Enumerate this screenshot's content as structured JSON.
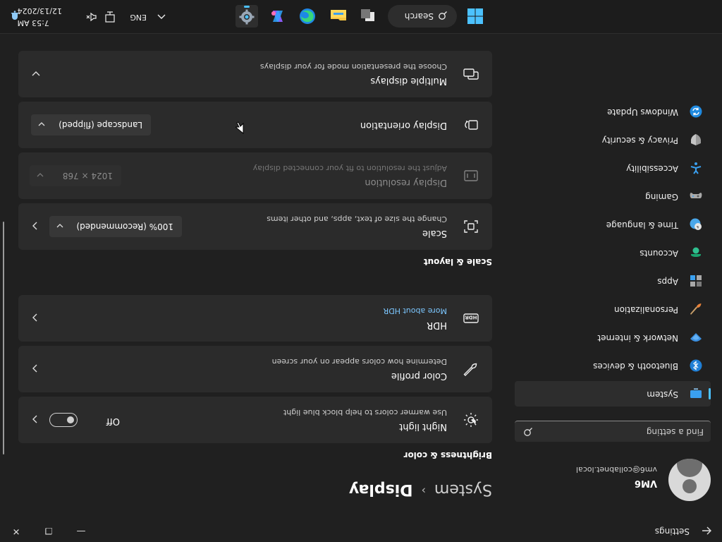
{
  "window": {
    "title": "Settings",
    "minimize": "—",
    "maximize": "❐",
    "close": "✕"
  },
  "profile": {
    "name": "VM6",
    "email": "vm6@collabnet.local"
  },
  "search": {
    "placeholder": "Find a setting"
  },
  "nav": [
    {
      "label": "System",
      "icon": "system-icon",
      "active": true
    },
    {
      "label": "Bluetooth & devices",
      "icon": "bluetooth-icon"
    },
    {
      "label": "Network & internet",
      "icon": "network-icon"
    },
    {
      "label": "Personalization",
      "icon": "brush-icon"
    },
    {
      "label": "Apps",
      "icon": "apps-icon"
    },
    {
      "label": "Accounts",
      "icon": "accounts-icon"
    },
    {
      "label": "Time & language",
      "icon": "globe-clock-icon"
    },
    {
      "label": "Gaming",
      "icon": "gamepad-icon"
    },
    {
      "label": "Accessibility",
      "icon": "accessibility-icon"
    },
    {
      "label": "Privacy & security",
      "icon": "shield-icon"
    },
    {
      "label": "Windows Update",
      "icon": "update-icon"
    }
  ],
  "header": {
    "parent": "System",
    "separator": "›",
    "current": "Display"
  },
  "sections": {
    "brightness": "Brightness & color",
    "scale": "Scale & layout"
  },
  "cards": {
    "night_light": {
      "title": "Night light",
      "subtitle": "Use warmer colors to help block blue light",
      "toggle_state": "Off",
      "toggle_on": false
    },
    "color_profile": {
      "title": "Color profile",
      "subtitle": "Determine how colors appear on your screen"
    },
    "hdr": {
      "title": "HDR",
      "link": "More about HDR"
    },
    "scale": {
      "title": "Scale",
      "subtitle": "Change the size of text, apps, and other items",
      "value": "100% (Recommended)"
    },
    "resolution": {
      "title": "Display resolution",
      "subtitle": "Adjust the resolution to fit your connected display",
      "value": "1024 × 768"
    },
    "orientation": {
      "title": "Display orientation",
      "value": "Landscape (flipped)"
    },
    "multiple": {
      "title": "Multiple displays",
      "subtitle": "Choose the presentation mode for your displays"
    }
  },
  "taskbar": {
    "search_label": "Search",
    "apps": [
      "start-icon",
      "search-icon",
      "task-view-icon",
      "file-explorer-icon",
      "edge-icon",
      "copilot-icon",
      "settings-icon"
    ],
    "active_app": "settings-icon",
    "language": "ENG",
    "time": "7:53 AM",
    "date": "12/13/2024"
  },
  "colors": {
    "accent": "#4cc2ff",
    "background": "#202020",
    "card": "#2b2b2b"
  }
}
